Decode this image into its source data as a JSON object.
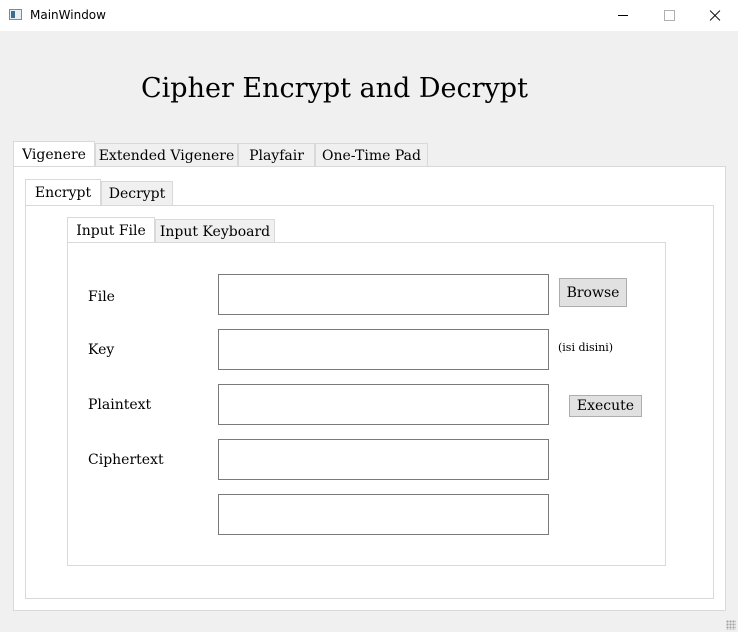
{
  "window": {
    "title": "MainWindow"
  },
  "heading": "Cipher Encrypt and Decrypt",
  "cipher_tabs": [
    {
      "label": "Vigenere",
      "active": true
    },
    {
      "label": "Extended Vigenere",
      "active": false
    },
    {
      "label": "Playfair",
      "active": false
    },
    {
      "label": "One-Time Pad",
      "active": false
    }
  ],
  "mode_tabs": [
    {
      "label": "Encrypt",
      "active": true
    },
    {
      "label": "Decrypt",
      "active": false
    }
  ],
  "input_tabs": [
    {
      "label": "Input File",
      "active": true
    },
    {
      "label": "Input Keyboard",
      "active": false
    }
  ],
  "form": {
    "file_label": "File",
    "key_label": "Key",
    "plaintext_label": "Plaintext",
    "ciphertext_label": "Ciphertext",
    "file_value": "",
    "key_value": "",
    "plaintext_value": "",
    "ciphertext_value": "",
    "extra_value": "",
    "browse_label": "Browse",
    "key_hint": "(isi disini)",
    "execute_label": "Execute"
  }
}
